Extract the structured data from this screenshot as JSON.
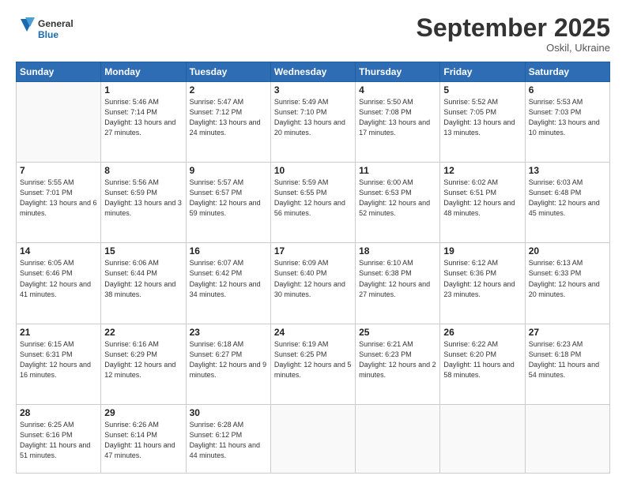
{
  "header": {
    "logo_general": "General",
    "logo_blue": "Blue",
    "month_title": "September 2025",
    "location": "Oskil, Ukraine"
  },
  "days_of_week": [
    "Sunday",
    "Monday",
    "Tuesday",
    "Wednesday",
    "Thursday",
    "Friday",
    "Saturday"
  ],
  "weeks": [
    [
      {
        "day": "",
        "empty": true
      },
      {
        "day": "1",
        "sunrise": "5:46 AM",
        "sunset": "7:14 PM",
        "daylight": "13 hours and 27 minutes."
      },
      {
        "day": "2",
        "sunrise": "5:47 AM",
        "sunset": "7:12 PM",
        "daylight": "13 hours and 24 minutes."
      },
      {
        "day": "3",
        "sunrise": "5:49 AM",
        "sunset": "7:10 PM",
        "daylight": "13 hours and 20 minutes."
      },
      {
        "day": "4",
        "sunrise": "5:50 AM",
        "sunset": "7:08 PM",
        "daylight": "13 hours and 17 minutes."
      },
      {
        "day": "5",
        "sunrise": "5:52 AM",
        "sunset": "7:05 PM",
        "daylight": "13 hours and 13 minutes."
      },
      {
        "day": "6",
        "sunrise": "5:53 AM",
        "sunset": "7:03 PM",
        "daylight": "13 hours and 10 minutes."
      }
    ],
    [
      {
        "day": "7",
        "sunrise": "5:55 AM",
        "sunset": "7:01 PM",
        "daylight": "13 hours and 6 minutes."
      },
      {
        "day": "8",
        "sunrise": "5:56 AM",
        "sunset": "6:59 PM",
        "daylight": "13 hours and 3 minutes."
      },
      {
        "day": "9",
        "sunrise": "5:57 AM",
        "sunset": "6:57 PM",
        "daylight": "12 hours and 59 minutes."
      },
      {
        "day": "10",
        "sunrise": "5:59 AM",
        "sunset": "6:55 PM",
        "daylight": "12 hours and 56 minutes."
      },
      {
        "day": "11",
        "sunrise": "6:00 AM",
        "sunset": "6:53 PM",
        "daylight": "12 hours and 52 minutes."
      },
      {
        "day": "12",
        "sunrise": "6:02 AM",
        "sunset": "6:51 PM",
        "daylight": "12 hours and 48 minutes."
      },
      {
        "day": "13",
        "sunrise": "6:03 AM",
        "sunset": "6:48 PM",
        "daylight": "12 hours and 45 minutes."
      }
    ],
    [
      {
        "day": "14",
        "sunrise": "6:05 AM",
        "sunset": "6:46 PM",
        "daylight": "12 hours and 41 minutes."
      },
      {
        "day": "15",
        "sunrise": "6:06 AM",
        "sunset": "6:44 PM",
        "daylight": "12 hours and 38 minutes."
      },
      {
        "day": "16",
        "sunrise": "6:07 AM",
        "sunset": "6:42 PM",
        "daylight": "12 hours and 34 minutes."
      },
      {
        "day": "17",
        "sunrise": "6:09 AM",
        "sunset": "6:40 PM",
        "daylight": "12 hours and 30 minutes."
      },
      {
        "day": "18",
        "sunrise": "6:10 AM",
        "sunset": "6:38 PM",
        "daylight": "12 hours and 27 minutes."
      },
      {
        "day": "19",
        "sunrise": "6:12 AM",
        "sunset": "6:36 PM",
        "daylight": "12 hours and 23 minutes."
      },
      {
        "day": "20",
        "sunrise": "6:13 AM",
        "sunset": "6:33 PM",
        "daylight": "12 hours and 20 minutes."
      }
    ],
    [
      {
        "day": "21",
        "sunrise": "6:15 AM",
        "sunset": "6:31 PM",
        "daylight": "12 hours and 16 minutes."
      },
      {
        "day": "22",
        "sunrise": "6:16 AM",
        "sunset": "6:29 PM",
        "daylight": "12 hours and 12 minutes."
      },
      {
        "day": "23",
        "sunrise": "6:18 AM",
        "sunset": "6:27 PM",
        "daylight": "12 hours and 9 minutes."
      },
      {
        "day": "24",
        "sunrise": "6:19 AM",
        "sunset": "6:25 PM",
        "daylight": "12 hours and 5 minutes."
      },
      {
        "day": "25",
        "sunrise": "6:21 AM",
        "sunset": "6:23 PM",
        "daylight": "12 hours and 2 minutes."
      },
      {
        "day": "26",
        "sunrise": "6:22 AM",
        "sunset": "6:20 PM",
        "daylight": "11 hours and 58 minutes."
      },
      {
        "day": "27",
        "sunrise": "6:23 AM",
        "sunset": "6:18 PM",
        "daylight": "11 hours and 54 minutes."
      }
    ],
    [
      {
        "day": "28",
        "sunrise": "6:25 AM",
        "sunset": "6:16 PM",
        "daylight": "11 hours and 51 minutes."
      },
      {
        "day": "29",
        "sunrise": "6:26 AM",
        "sunset": "6:14 PM",
        "daylight": "11 hours and 47 minutes."
      },
      {
        "day": "30",
        "sunrise": "6:28 AM",
        "sunset": "6:12 PM",
        "daylight": "11 hours and 44 minutes."
      },
      {
        "day": "",
        "empty": true
      },
      {
        "day": "",
        "empty": true
      },
      {
        "day": "",
        "empty": true
      },
      {
        "day": "",
        "empty": true
      }
    ]
  ],
  "labels": {
    "sunrise": "Sunrise:",
    "sunset": "Sunset:",
    "daylight": "Daylight:"
  }
}
